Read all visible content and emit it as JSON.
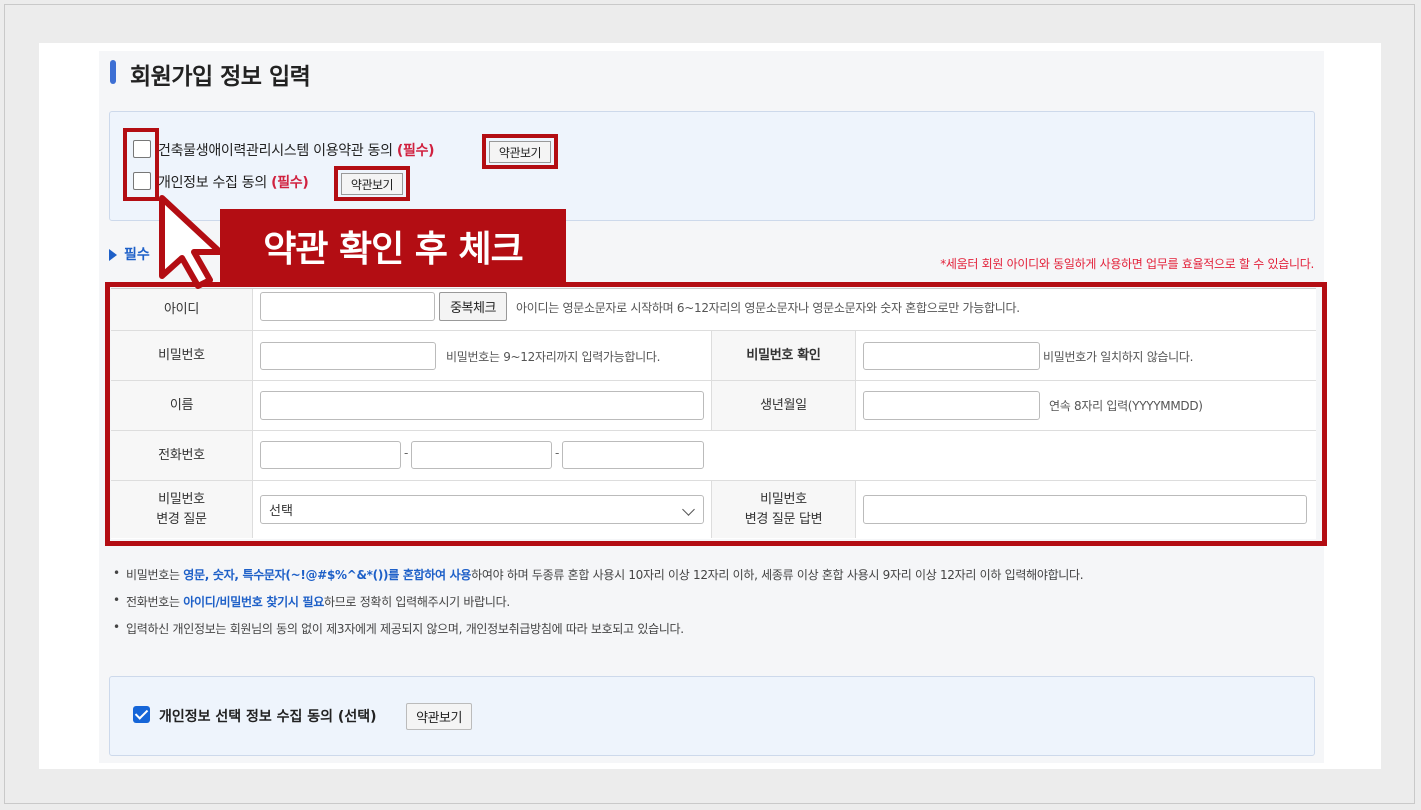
{
  "page": {
    "title": "회원가입 정보 입력"
  },
  "agreements": {
    "terms_text": "건축물생애이력관리시스템 이용약관 동의",
    "privacy_text": "개인정보 수집 동의",
    "required_mark": "(필수)",
    "view_button": "약관보기"
  },
  "annotation": {
    "banner": "약관 확인 후 체크"
  },
  "section": {
    "label": "필수",
    "note": "*세움터 회원 아이디와 동일하게 사용하면 업무를 효율적으로 할 수 있습니다."
  },
  "form": {
    "id_label": "아이디",
    "id_value": "",
    "dup_check_button": "중복체크",
    "id_hint": "아이디는 영문소문자로 시작하며 6~12자리의 영문소문자나 영문소문자와 숫자 혼합으로만 가능합니다.",
    "pw_label": "비밀번호",
    "pw_value": "",
    "pw_hint": "비밀번호는 9~12자리까지 입력가능합니다.",
    "pw_confirm_label": "비밀번호 확인",
    "pw_confirm_value": "",
    "pw_confirm_hint": "비밀번호가 일치하지 않습니다.",
    "name_label": "이름",
    "name_value": "",
    "birth_label": "생년월일",
    "birth_value": "",
    "birth_hint": "연속 8자리 입력(YYYYMMDD)",
    "phone_label": "전화번호",
    "phone_sep": "-",
    "phone_values": [
      "",
      "",
      ""
    ],
    "question_label_1": "비밀번호",
    "question_label_2": "변경 질문",
    "question_selected": "선택",
    "answer_label_1": "비밀번호",
    "answer_label_2": "변경 질문 답변",
    "answer_value": ""
  },
  "notes": {
    "n1_a": "비밀번호는 ",
    "n1_hl": "영문, 숫자, 특수문자(~!@#$%^&*())를 혼합하여 사용",
    "n1_b": "하여야 하며 두종류 혼합 사용시 10자리 이상 12자리 이하, 세종류 이상 혼합 사용시 9자리 이상 12자리 이하 입력해야합니다.",
    "n2_a": "전화번호는 ",
    "n2_hl": "아이디/비밀번호 찾기시 필요",
    "n2_b": "하므로 정확히 입력해주시기 바랍니다.",
    "n3": "입력하신 개인정보는 회원님의 동의 없이 제3자에게 제공되지 않으며, 개인정보취급방침에 따라 보호되고 있습니다."
  },
  "optional_agreement": {
    "text": "개인정보 선택 정보 수집 동의 (선택)",
    "checked": true,
    "view_button": "약관보기"
  },
  "colors": {
    "accent": "#1e60c8",
    "annotation_red": "#b30d13",
    "required_red": "#d0213f"
  }
}
